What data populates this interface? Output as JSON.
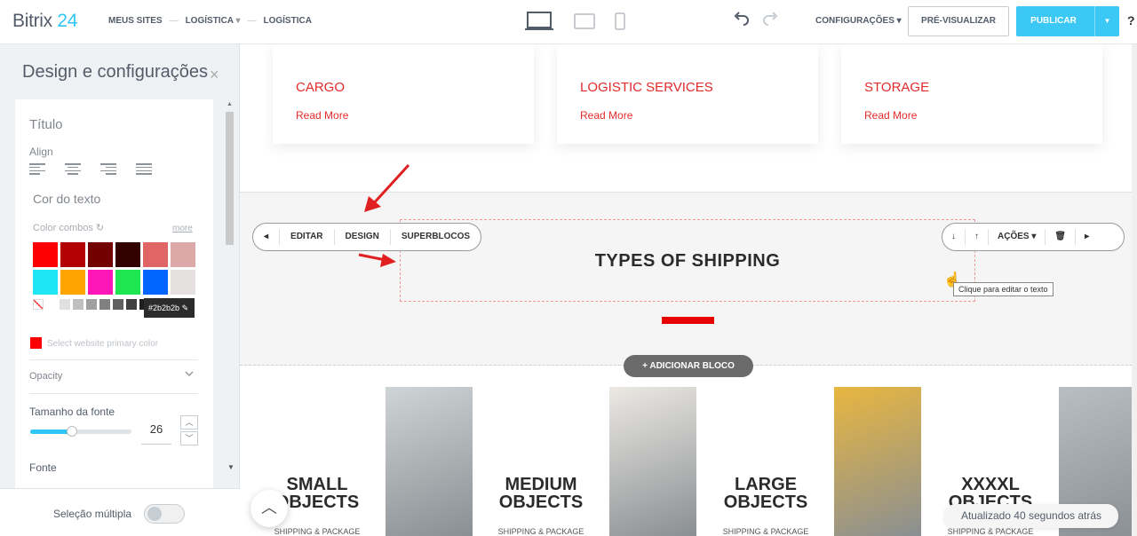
{
  "topbar": {
    "logo_text": "Bitrix",
    "logo_num": "24",
    "crumbs": [
      "MEUS SITES",
      "LOGÍSTICA",
      "LOGÍSTICA"
    ],
    "crumb_sep": "—",
    "crumb_arrow": "▾",
    "settings": "CONFIGURAÇÕES ▾",
    "preview": "PRÉ-VISUALIZAR",
    "publish": "PUBLICAR",
    "publish_arrow": "▼",
    "help": "?"
  },
  "sidebar": {
    "title": "Design e configurações",
    "close": "×",
    "section_title": "Título",
    "align_label": "Align",
    "text_color_label": "Cor do texto",
    "color_combos": "Color combos",
    "more": "more",
    "hex_value": "#2b2b2b",
    "primary_label": "Select website primary color",
    "opacity_label": "Opacity",
    "font_size_label": "Tamanho da fonte",
    "font_size_value": "26",
    "font_label": "Fonte",
    "multi_select": "Seleção múltipla",
    "slider_fraction": 0.4,
    "swatches": [
      "#ff0000",
      "#b30000",
      "#730000",
      "#330000",
      "#e06666",
      "#dda8a8",
      "#1ee6f5",
      "#ffa500",
      "#ff16b9",
      "#1ee650",
      "#0066ff",
      "#e6e1e1"
    ],
    "greys": [
      "#ffffff",
      "#e0e0e0",
      "#c0c0c0",
      "#a0a0a0",
      "#808080",
      "#606060",
      "#404040",
      "#202020",
      "#000000"
    ]
  },
  "services": [
    {
      "title": "CARGO",
      "link": "Read More"
    },
    {
      "title": "LOGISTIC SERVICES",
      "link": "Read More"
    },
    {
      "title": "STORAGE",
      "link": "Read More"
    }
  ],
  "block_controls": {
    "left": [
      "◂",
      "EDITAR",
      "DESIGN",
      "SUPERBLOCOS"
    ],
    "down": "↓",
    "up": "↑",
    "actions": "AÇÕES ▾",
    "delete": "🗑",
    "next": "▸"
  },
  "section": {
    "heading": "TYPES OF SHIPPING",
    "tooltip": "Clique para editar o texto"
  },
  "add_block": "+ ADICIONAR BLOCO",
  "products": [
    {
      "name": "SMALL OBJECTS",
      "sub": "SHIPPING & PACKAGE",
      "img_color": "#cfd4d6"
    },
    {
      "name": "MEDIUM OBJECTS",
      "sub": "SHIPPING & PACKAGE",
      "img_color": "#ece9e4"
    },
    {
      "name": "LARGE OBJECTS",
      "sub": "SHIPPING & PACKAGE",
      "img_color": "#e8b640"
    },
    {
      "name": "XXXXL OBJECTS",
      "sub": "SHIPPING & PACKAGE",
      "img_color": "#b9bec2"
    }
  ],
  "updated": "Atualizado 40 segundos atrás",
  "scroll_up": "︿"
}
